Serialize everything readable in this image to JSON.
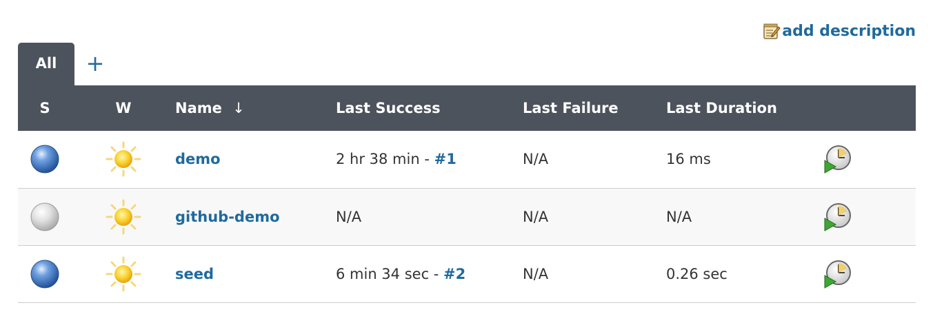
{
  "header": {
    "add_description_label": "add description",
    "add_description_icon": "notepad-icon"
  },
  "tabs": [
    {
      "label": "All",
      "active": true
    },
    {
      "label": "+",
      "active": false
    }
  ],
  "table": {
    "headers": {
      "status": "S",
      "weather": "W",
      "name": "Name",
      "sort_indicator": "↓",
      "last_success": "Last Success",
      "last_failure": "Last Failure",
      "last_duration": "Last Duration"
    },
    "rows": [
      {
        "status": "blue",
        "weather": "sunny",
        "name": "demo",
        "last_success_text": "2 hr 38 min - ",
        "last_success_build": "#1",
        "last_failure": "N/A",
        "last_duration": "16 ms"
      },
      {
        "status": "grey",
        "weather": "sunny",
        "name": "github-demo",
        "last_success_text": "N/A",
        "last_success_build": "",
        "last_failure": "N/A",
        "last_duration": "N/A"
      },
      {
        "status": "blue",
        "weather": "sunny",
        "name": "seed",
        "last_success_text": "6 min 34 sec - ",
        "last_success_build": "#2",
        "last_failure": "N/A",
        "last_duration": "0.26 sec"
      }
    ]
  },
  "colors": {
    "header_bg": "#4d535d",
    "link": "#1f6a9d",
    "status_blue": "#2f6fc0",
    "status_grey": "#c8c8c8",
    "sun": "#f7c31a"
  }
}
